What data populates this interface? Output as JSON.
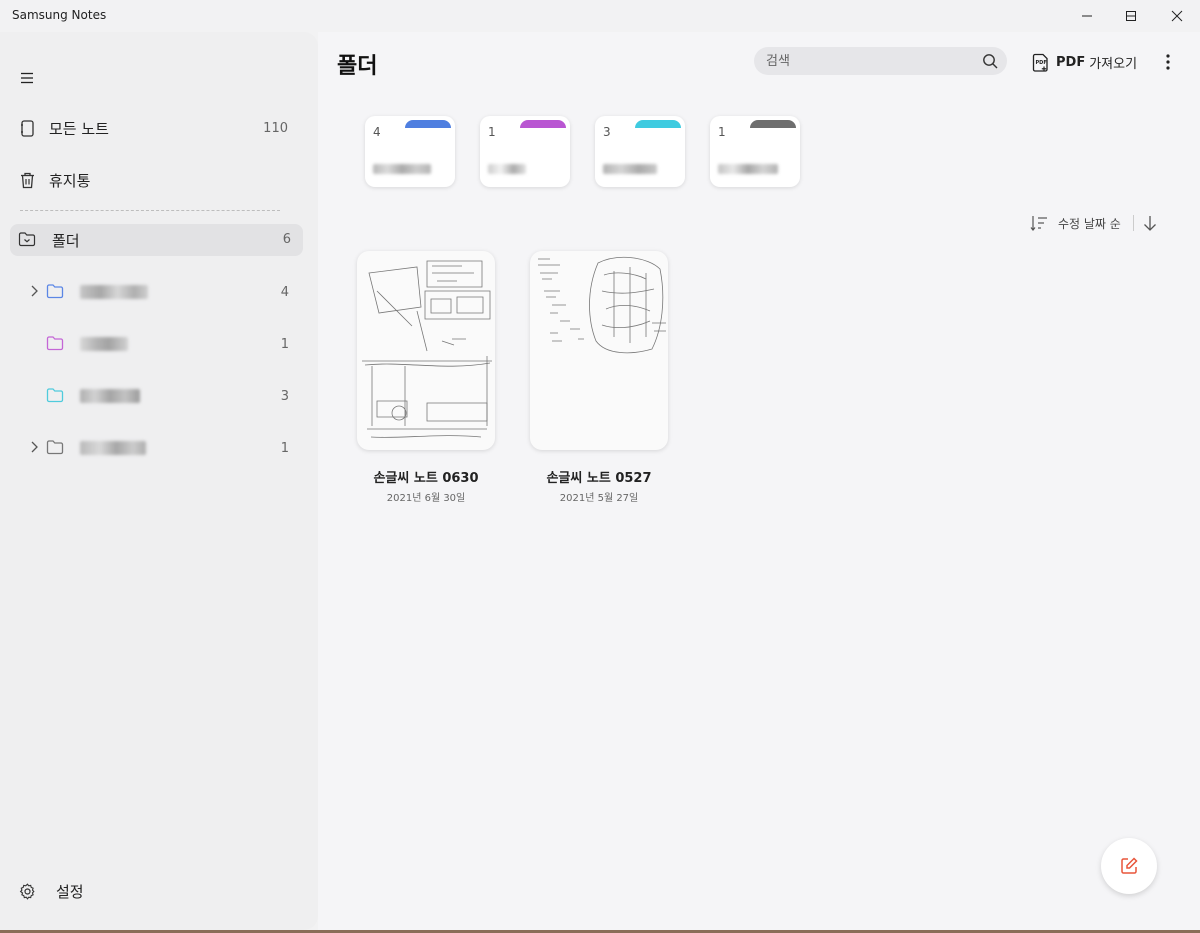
{
  "window": {
    "title": "Samsung Notes",
    "minimize_icon": "minimize-icon",
    "maximize_icon": "maximize-icon",
    "close_icon": "close-icon"
  },
  "sidebar": {
    "menu_icon": "hamburger-menu-icon",
    "all_notes": {
      "label": "모든 노트",
      "count": "110",
      "icon": "notebook-icon"
    },
    "trash": {
      "label": "휴지통",
      "icon": "trash-icon"
    },
    "folders": {
      "label": "폴더",
      "count": "6",
      "icon": "folder-collapse-icon"
    },
    "folder_items": [
      {
        "count": "4",
        "color": "#5b86e5",
        "expandable": true
      },
      {
        "count": "1",
        "color": "#c466d6",
        "expandable": false
      },
      {
        "count": "3",
        "color": "#4fcbdc",
        "expandable": false
      },
      {
        "count": "1",
        "color": "#777777",
        "expandable": true
      }
    ],
    "settings": {
      "label": "설정",
      "icon": "gear-icon"
    }
  },
  "main": {
    "title": "폴더",
    "search": {
      "placeholder": "검색",
      "value": ""
    },
    "pdf_import": {
      "label": "가져오기",
      "badge": "PDF"
    },
    "more_icon": "more-vertical-icon",
    "folder_cards": [
      {
        "count": "4",
        "color": "#4f7fe0"
      },
      {
        "count": "1",
        "color": "#b956d2"
      },
      {
        "count": "3",
        "color": "#3fcbe0"
      },
      {
        "count": "1",
        "color": "#6e6e6e"
      }
    ],
    "sort": {
      "label": "수정 날짜 순",
      "icon": "sort-icon",
      "direction_icon": "arrow-down-icon"
    },
    "notes": [
      {
        "title": "손글씨 노트 0630",
        "date": "2021년 6월 30일"
      },
      {
        "title": "손글씨 노트 0527",
        "date": "2021년 5월 27일"
      }
    ],
    "fab_icon": "new-note-icon",
    "accent": "#e8553a"
  }
}
